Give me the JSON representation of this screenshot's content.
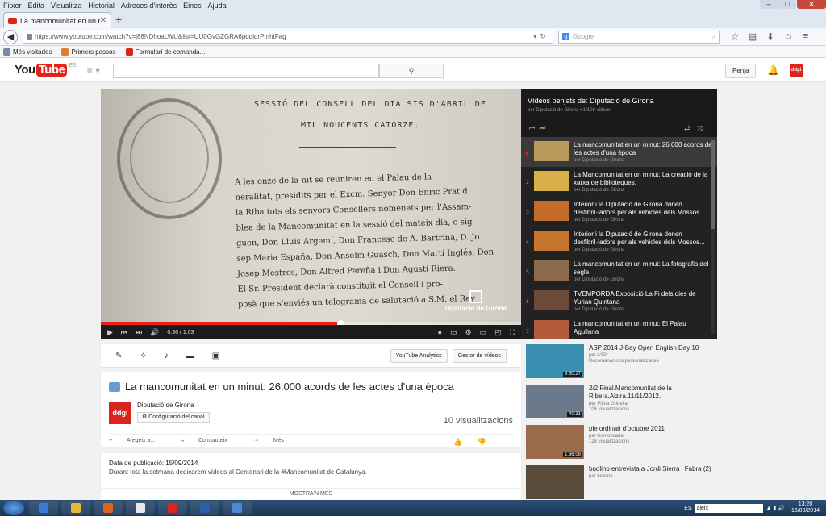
{
  "firefox": {
    "menu": [
      "Fitxer",
      "Edita",
      "Visualitza",
      "Historial",
      "Adreces d'interès",
      "Eines",
      "Ajuda"
    ],
    "tab_title": "La mancomunitat en un mi...",
    "url": "https://www.youtube.com/watch?v=j88NDhoaLWU&list=UU0GvGZGRA6pqdiqrPmhtFag",
    "search_placeholder": "Google",
    "bookmarks": [
      "Més visitades",
      "Primers passos",
      "Formulari de comanda..."
    ]
  },
  "youtube": {
    "logo_you": "You",
    "logo_tube": "Tube",
    "logo_region": "ES",
    "upload_label": "Penja",
    "avatar_text": "ddgi"
  },
  "video": {
    "doc_heading_1": "SESSIÓ DEL CONSELL DEL DIA SIS D'ABRIL DE",
    "doc_heading_2": "MIL NOUCENTS CATORZE.",
    "doc_lines": [
      "A les onze de la nit se reuniren en el Palau de la",
      "neralitat, presidits per el Excm. Senyor Don Enric Prat d",
      "la Riba tots els senyors Consellers nomenats per l'Assam-",
      "blea de la Mancomunitat en la sessió del mateix dia, o sig",
      "guen, Don Lluis Argemí, Don Francesc de A. Bartrina, D. Jo",
      "sep Maria España, Don Anselm Guasch, Don Martí Inglés, Don",
      "Josep Mestres, Don Alfred Pereña i Don Agustí Riera.",
      "El Sr. President declarà constituit el Consell i pro-",
      "posà que s'enviés un telegrama de salutació a S.M. el Rey"
    ],
    "watermark": "Diputació de Girona",
    "time_current": "0:36",
    "time_total": "1:03",
    "progress": 0.57
  },
  "playlist": {
    "title": "Vídeos penjats de: Diputació de Girona",
    "subtitle": "per Diputació de Girona • 1/108 vídeos",
    "items": [
      {
        "num": "▶",
        "title": "La mancomunitat en un minut: 26.000 acords de les actes d'una època",
        "by": "per Diputació de Girona"
      },
      {
        "num": "2",
        "title": "La Mancomunitat en un minut: La creació de la xarxa de biblioteques.",
        "by": "per Diputació de Girona"
      },
      {
        "num": "3",
        "title": "Interior i la Diputació de Girona donen desfibril·ladors per als vehicles dels Mossos...",
        "by": "per Diputació de Girona"
      },
      {
        "num": "4",
        "title": "Interior i la Diputació de Girona donen desfibril·ladors per als vehicles dels Mossos...",
        "by": "per Diputació de Girona"
      },
      {
        "num": "5",
        "title": "La mancomunitat en un minut: La fotografia del segle.",
        "by": "per Diputació de Girona"
      },
      {
        "num": "6",
        "title": "TVEMPORDA Exposició La Fi dels dies de Yurian Quintana",
        "by": "per Diputació de Girona"
      },
      {
        "num": "7",
        "title": "La mancomunitat en un minut: El Palau Agullana",
        "by": ""
      }
    ],
    "thumb_colors": [
      "#b89a5c",
      "#d8b04a",
      "#c46a2a",
      "#c8762e",
      "#8a6a4a",
      "#6b4a3a",
      "#b55a3a"
    ]
  },
  "actions": {
    "analytics": "YouTube Analytics",
    "manager": "Gestor de vídeos"
  },
  "info": {
    "title": "La mancomunitat en un minut: 26.000 acords de les actes d'una època",
    "channel": "Diputació de Girona",
    "channel_avatar": "ddgi",
    "channel_settings": "Configuració del canal",
    "views": "10 visualitzacions",
    "add_to": "Afegeix a...",
    "share": "Comparteix",
    "more": "Més"
  },
  "description": {
    "published": "Data de publicació: 15/09/2014",
    "text": "Durant tota la setmana dedicarem vídeos al Centenari de la #Mancomunitat de Catalunya.",
    "show_more": "MOSTRA'N MÉS"
  },
  "related": [
    {
      "title": "ASP 2014 J-Bay Open English Day 10",
      "by": "per ASP",
      "meta": "Recomanacions personalitzades",
      "duration": "9:30:27",
      "color": "#3a8fb0"
    },
    {
      "title": "2/2.Final.Mancomunitat de la Ribera.Alzira.11/11/2012.",
      "by": "per Pilota Godella",
      "meta": "106 visualitzacions",
      "duration": "40:31",
      "color": "#6b7a8a"
    },
    {
      "title": "ple ordinari d'octubre 2011",
      "by": "per lesmoncada",
      "meta": "128 visualitzacions",
      "duration": "1:36:06",
      "color": "#9a6a4a"
    },
    {
      "title": "boolino entrevista a Jordi Sierra i Fabra (2)",
      "by": "per boolino",
      "meta": "",
      "duration": "",
      "color": "#5a4a3a"
    }
  ],
  "taskbar": {
    "lang": "ES",
    "search_text": "aleix",
    "time": "13:20",
    "date": "16/09/2014",
    "icon_colors": [
      "#3a7bd5",
      "#e8b83a",
      "#d9661a",
      "#e9e9e9",
      "#d9251c",
      "#2a5fa8",
      "#4a8ad0"
    ]
  }
}
